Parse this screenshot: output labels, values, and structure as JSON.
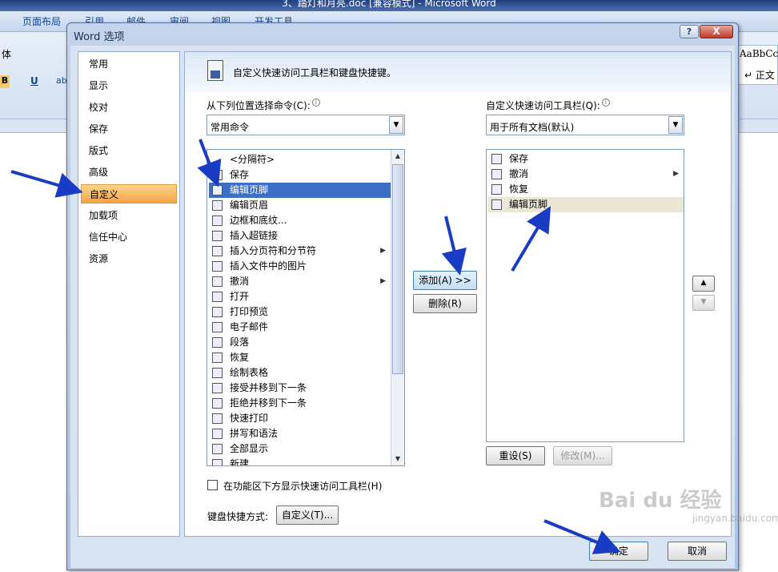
{
  "window": {
    "title": "3、踏灯和月亮.doc [兼容模式] - Microsoft Word"
  },
  "ribbon_tabs": [
    "页面布局",
    "引用",
    "邮件",
    "审阅",
    "视图",
    "开发工具"
  ],
  "background": {
    "font_label": "体",
    "style_sample": "AaBbCcD",
    "style_name": "↵ 正文"
  },
  "dialog": {
    "title": "Word 选项",
    "help": "?",
    "close": "X",
    "nav": [
      {
        "label": "常用"
      },
      {
        "label": "显示"
      },
      {
        "label": "校对"
      },
      {
        "label": "保存"
      },
      {
        "label": "版式"
      },
      {
        "label": "高级"
      },
      {
        "label": "自定义",
        "active": true
      },
      {
        "label": "加载项"
      },
      {
        "label": "信任中心"
      },
      {
        "label": "资源"
      }
    ],
    "header": "自定义快速访问工具栏和键盘快捷键。",
    "left_label": "从下列位置选择命令(C):",
    "left_combo": "常用命令",
    "right_label": "自定义快速访问工具栏(Q):",
    "right_combo": "用于所有文档(默认)",
    "commands": [
      {
        "label": "<分隔符>",
        "icon": ""
      },
      {
        "label": "保存",
        "icon": "save-icon"
      },
      {
        "label": "编辑页脚",
        "icon": "footer-icon",
        "selected": true
      },
      {
        "label": "编辑页眉",
        "icon": "header-icon"
      },
      {
        "label": "边框和底纹...",
        "icon": "border-icon"
      },
      {
        "label": "插入超链接",
        "icon": "hyperlink-icon"
      },
      {
        "label": "插入分页符和分节符",
        "icon": "page-break-icon",
        "submenu": true
      },
      {
        "label": "插入文件中的图片",
        "icon": "picture-icon"
      },
      {
        "label": "撤消",
        "icon": "undo-icon",
        "submenu": true
      },
      {
        "label": "打开",
        "icon": "open-folder-icon"
      },
      {
        "label": "打印预览",
        "icon": "print-preview-icon"
      },
      {
        "label": "电子邮件",
        "icon": "email-icon"
      },
      {
        "label": "段落",
        "icon": "paragraph-icon"
      },
      {
        "label": "恢复",
        "icon": "redo-icon"
      },
      {
        "label": "绘制表格",
        "icon": "draw-table-icon"
      },
      {
        "label": "接受并移到下一条",
        "icon": "accept-icon"
      },
      {
        "label": "拒绝并移到下一条",
        "icon": "reject-icon"
      },
      {
        "label": "快速打印",
        "icon": "quick-print-icon"
      },
      {
        "label": "拼写和语法",
        "icon": "spelling-icon"
      },
      {
        "label": "全部显示",
        "icon": "show-all-icon"
      },
      {
        "label": "新建",
        "icon": "new-doc-icon"
      }
    ],
    "toolbar_items": [
      {
        "label": "保存",
        "icon": "save-icon"
      },
      {
        "label": "撤消",
        "icon": "undo-icon",
        "submenu": true
      },
      {
        "label": "恢复",
        "icon": "redo-icon"
      },
      {
        "label": "编辑页脚",
        "icon": "footer-icon",
        "highlighted": true
      }
    ],
    "add_button": "添加(A) >>",
    "remove_button": "删除(R)",
    "move_up": "▲",
    "move_down": "▼",
    "reset_button": "重设(S)",
    "modify_button": "修改(M)...",
    "show_below_ribbon": "在功能区下方显示快速访问工具栏(H)",
    "keyboard_label": "键盘快捷方式:",
    "customize_button": "自定义(T)...",
    "ok_button": "确定",
    "cancel_button": "取消"
  },
  "watermark": {
    "text": "Bai du 经验",
    "sub": "jingyan.baidu.com"
  },
  "colors": {
    "selection": "#3d6fc7",
    "nav_active": "#f6a44a",
    "annotation_arrow": "#1a3bc4"
  }
}
